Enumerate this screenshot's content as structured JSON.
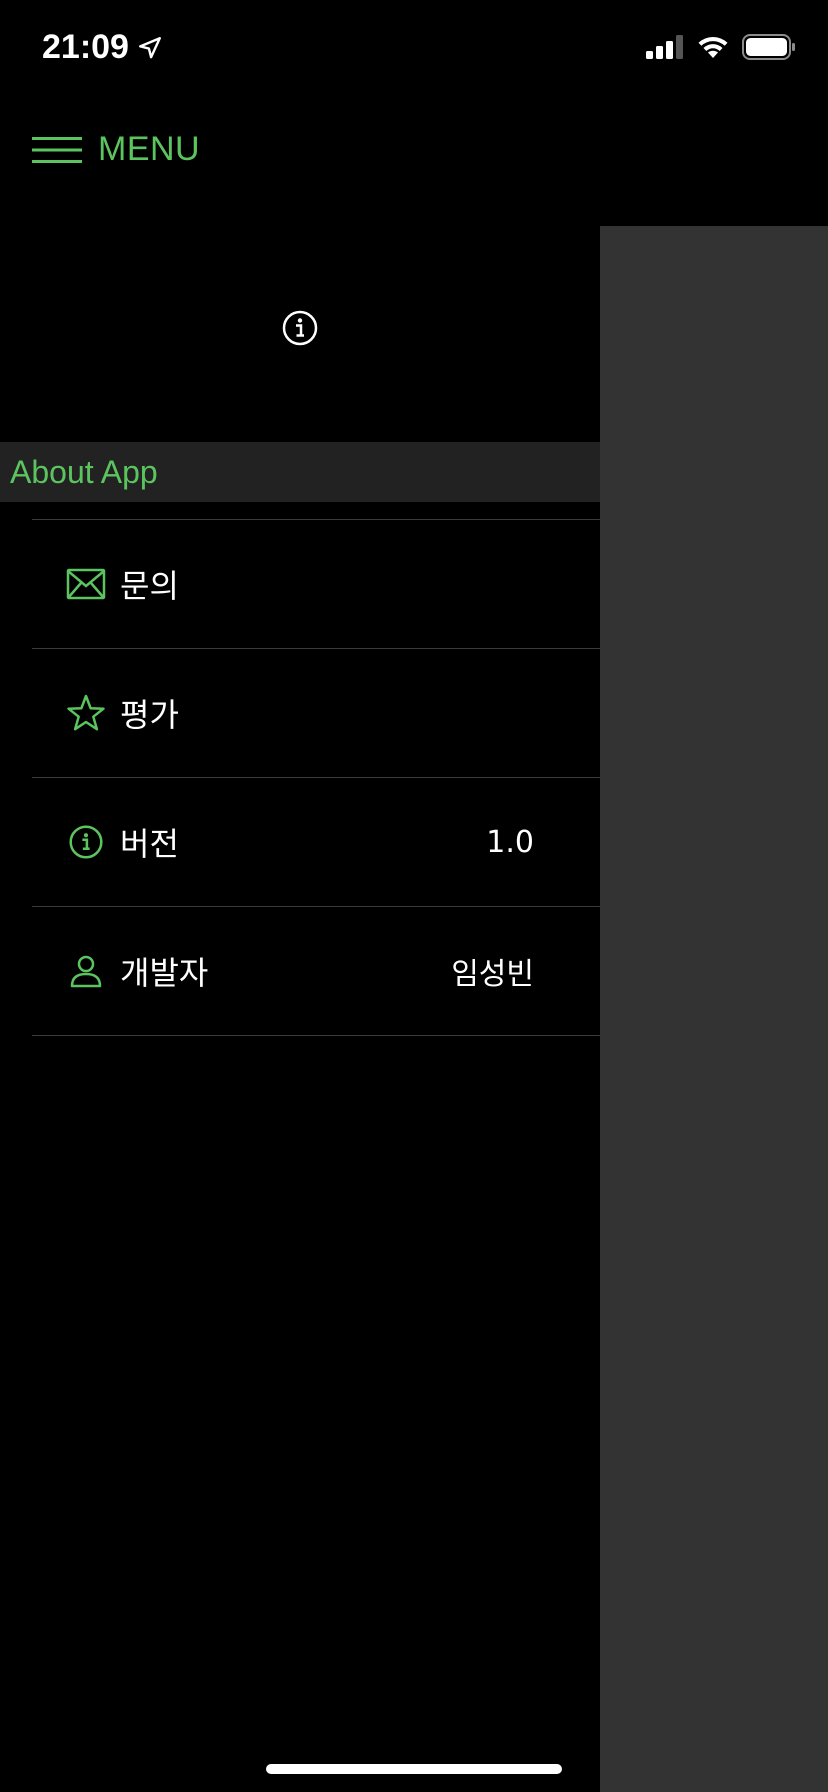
{
  "status_bar": {
    "time": "21:09",
    "icons": [
      "location-arrow-icon",
      "cellular-signal-icon",
      "wifi-icon",
      "battery-icon"
    ]
  },
  "header": {
    "menu_icon": "hamburger-icon",
    "menu_label": "MENU"
  },
  "drawer": {
    "logo_icon": "info-circle-icon",
    "section_title": "About App",
    "items": [
      {
        "icon": "envelope-icon",
        "label": "문의",
        "value": ""
      },
      {
        "icon": "star-icon",
        "label": "평가",
        "value": ""
      },
      {
        "icon": "info-circle-icon",
        "label": "버전",
        "value": "1.0"
      },
      {
        "icon": "person-icon",
        "label": "개발자",
        "value": "임성빈"
      }
    ]
  },
  "colors": {
    "accent": "#5cc45f",
    "background": "#000000",
    "section_bg": "#222222",
    "overlay": "#333333",
    "separator": "#3a3a3a"
  }
}
